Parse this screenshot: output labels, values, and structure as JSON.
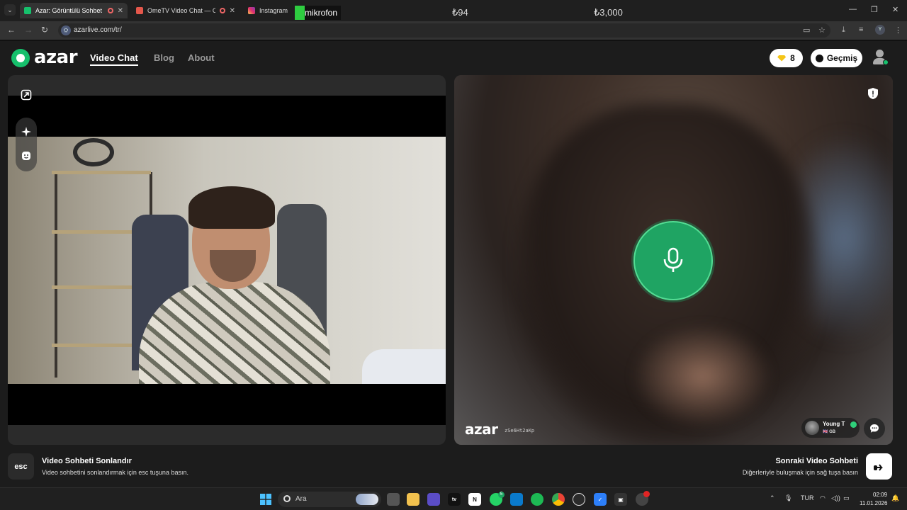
{
  "browser": {
    "tabs": [
      {
        "title": "Azar: Görüntülü Sohbet & V",
        "active": true
      },
      {
        "title": "OmeTV Video Chat — Ome",
        "active": false
      },
      {
        "title": "Instagram",
        "active": false
      }
    ],
    "overlay": {
      "mic_label": "mikrofon",
      "value_1": "₺94",
      "value_2": "₺3,000"
    },
    "url": "azarlive.com/tr/"
  },
  "site": {
    "logo": "azar",
    "nav": [
      {
        "label": "Video Chat",
        "active": true
      },
      {
        "label": "Blog",
        "active": false
      },
      {
        "label": "About",
        "active": false
      }
    ],
    "gems": "8",
    "history_label": "Geçmiş",
    "accent_color": "#16c06c"
  },
  "partner": {
    "watermark_logo": "azar",
    "watermark_id": "zSe6Ht2aKp",
    "name": "Young T",
    "country": "GB"
  },
  "hints": {
    "esc_key": "esc",
    "end_title": "Video Sohbeti Sonlandır",
    "end_sub": "Video sohbetini sonlandırmak için esc tuşuna basın.",
    "next_title": "Sonraki Video Sohbeti",
    "next_sub": "Diğerleriyle buluşmak için sağ tuşa basın"
  },
  "taskbar": {
    "search_placeholder": "Ara",
    "language": "TUR",
    "time": "02:09",
    "date": "11.01.2026",
    "whatsapp_badge": "5"
  }
}
